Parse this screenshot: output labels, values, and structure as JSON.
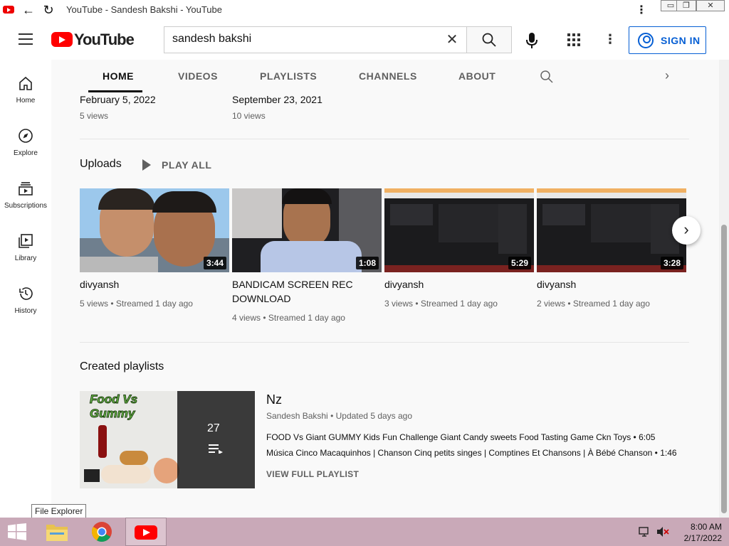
{
  "window": {
    "title": "YouTube - Sandesh Bakshi - YouTube",
    "controls": {
      "minimize": "▭",
      "maximize": "❐",
      "close": "✕"
    }
  },
  "header": {
    "logo_text": "YouTube",
    "search_value": "sandesh bakshi",
    "signin_label": "SIGN IN"
  },
  "guide": [
    {
      "label": "Home",
      "icon": "home-icon"
    },
    {
      "label": "Explore",
      "icon": "compass-icon"
    },
    {
      "label": "Subscriptions",
      "icon": "subscriptions-icon"
    },
    {
      "label": "Library",
      "icon": "library-icon"
    },
    {
      "label": "History",
      "icon": "history-icon"
    }
  ],
  "tabs": [
    "HOME",
    "VIDEOS",
    "PLAYLISTS",
    "CHANNELS",
    "ABOUT"
  ],
  "previous_row": [
    {
      "date": "February 5, 2022",
      "views": "5 views"
    },
    {
      "date": "September 23, 2021",
      "views": "10 views"
    }
  ],
  "uploads": {
    "title": "Uploads",
    "play_all": "PLAY ALL",
    "videos": [
      {
        "title": "divyansh",
        "duration": "3:44",
        "views": "5 views",
        "age": "Streamed 1 day ago"
      },
      {
        "title": "BANDICAM SCREEN REC DOWNLOAD",
        "duration": "1:08",
        "views": "4 views",
        "age": "Streamed 1 day ago"
      },
      {
        "title": "divyansh",
        "duration": "5:29",
        "views": "3 views",
        "age": "Streamed 1 day ago"
      },
      {
        "title": "divyansh",
        "duration": "3:28",
        "views": "2 views",
        "age": "Streamed 1 day ago"
      }
    ]
  },
  "playlists": {
    "title": "Created playlists",
    "item": {
      "name": "Nz",
      "thumb_text": "Food Vs Gummy",
      "count": "27",
      "channel": "Sandesh Bakshi",
      "updated": "Updated 5 days ago",
      "videos": [
        {
          "title": "FOOD Vs Giant GUMMY Kids Fun Challenge Giant Candy sweets Food Tasting Game Ckn Toys",
          "duration": "6:05"
        },
        {
          "title": "Música Cinco Macaquinhos | Chanson Cinq petits singes | Comptines Et Chansons | À Bébé Chanson",
          "duration": "1:46"
        }
      ],
      "view_full": "VIEW FULL PLAYLIST"
    }
  },
  "taskbar": {
    "tooltip": "File Explorer",
    "time": "8:00 AM",
    "date": "2/17/2022"
  }
}
